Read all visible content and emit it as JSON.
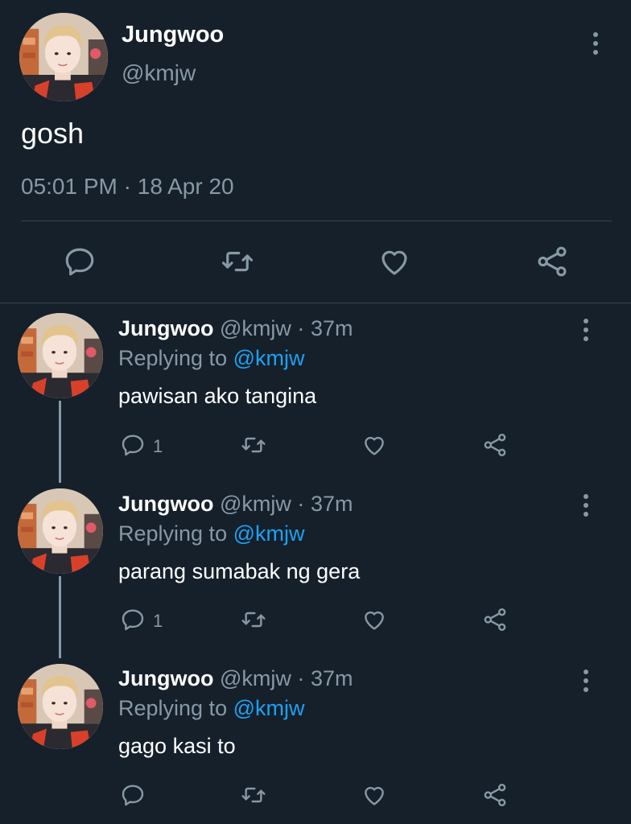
{
  "main_tweet": {
    "author_name": "Jungwoo",
    "author_handle": "@kmjw",
    "text": "gosh",
    "time": "05:01 PM",
    "separator": "·",
    "date": "18 Apr 20",
    "actions": [
      "reply-icon",
      "retweet-icon",
      "like-icon",
      "share-icon"
    ]
  },
  "replies": [
    {
      "author_name": "Jungwoo",
      "author_handle": "@kmjw",
      "separator": "·",
      "time_ago": "37m",
      "replying_label": "Replying to",
      "replying_to": "@kmjw",
      "text": "pawisan ako tangina",
      "reply_count": "1"
    },
    {
      "author_name": "Jungwoo",
      "author_handle": "@kmjw",
      "separator": "·",
      "time_ago": "37m",
      "replying_label": "Replying to",
      "replying_to": "@kmjw",
      "text": "parang sumabak ng gera",
      "reply_count": "1"
    },
    {
      "author_name": "Jungwoo",
      "author_handle": "@kmjw",
      "separator": "·",
      "time_ago": "37m",
      "replying_label": "Replying to",
      "replying_to": "@kmjw",
      "text": "gago kasi to",
      "reply_count": ""
    }
  ],
  "colors": {
    "background": "#15202b",
    "secondary_text": "#8899a6",
    "accent": "#1da1f2",
    "divider": "#38444d"
  }
}
